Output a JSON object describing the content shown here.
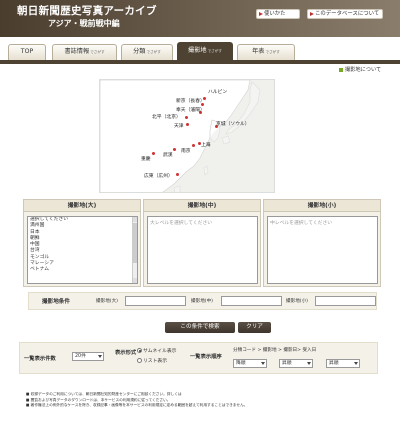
{
  "header": {
    "title_line1": "朝日新聞歴史写真アーカイブ",
    "title_line2": "アジア・戦前戦中編",
    "usage_button": "使いかた",
    "about_db_button": "このデータベースについて"
  },
  "tabs": [
    {
      "label": "TOP",
      "sub": ""
    },
    {
      "label": "書誌情報",
      "sub": "でさがす"
    },
    {
      "label": "分類",
      "sub": "でさがす"
    },
    {
      "label": "撮影地",
      "sub": "でさがす"
    },
    {
      "label": "年表",
      "sub": "でさがす"
    }
  ],
  "active_tab": "撮影地",
  "about_location": "撮影地について",
  "map": {
    "cities": [
      "ハルビン",
      "新京（長春）",
      "奉天（瀋陽）",
      "北平（北京）",
      "天津",
      "京城（ソウル）",
      "南京",
      "上海",
      "武漢",
      "重慶",
      "広東（広州）"
    ]
  },
  "panels": {
    "large": {
      "title": "撮影地(大)",
      "options": [
        "選択してください",
        "満州国",
        "日本",
        "朝鮮",
        "中国",
        "台湾",
        "モンゴル",
        "マレーシア",
        "ベトナム"
      ]
    },
    "medium": {
      "title": "撮影地(中)",
      "placeholder": "大レベルを選択してください"
    },
    "small": {
      "title": "撮影地(小)",
      "placeholder": "中レベルを選択してください"
    }
  },
  "conditions": {
    "label": "撮影地条件",
    "large_label": "撮影地(大)",
    "medium_label": "撮影地(中)",
    "small_label": "撮影地(小)"
  },
  "buttons": {
    "search": "この条件で検索",
    "clear": "クリア"
  },
  "display": {
    "count_label": "一覧表示件数",
    "count_value": "20件",
    "format_label": "表示形式",
    "format_thumbnail": "サムネイル表示",
    "format_list": "リスト表示",
    "sort_label": "一覧表示順序",
    "sort_sequence": [
      "分類コード",
      "撮影地",
      "撮影日",
      "受入日"
    ],
    "sort_value": "降順",
    "order_value_1": "昇順",
    "order_value_2": "昇順"
  },
  "notes": [
    "■ 収録データのご利用については、朝日新聞社知的財産センターにご相談ください。詳しくは",
    "■ 閲覧および写真データのダウンロードは、本サービスの利用規約に従ってください。",
    "■ 著作権法上の例外的なケースを除き、収録記事・画像等を本サービスの利用規定に定める範囲を超えて利用することはできません。"
  ]
}
